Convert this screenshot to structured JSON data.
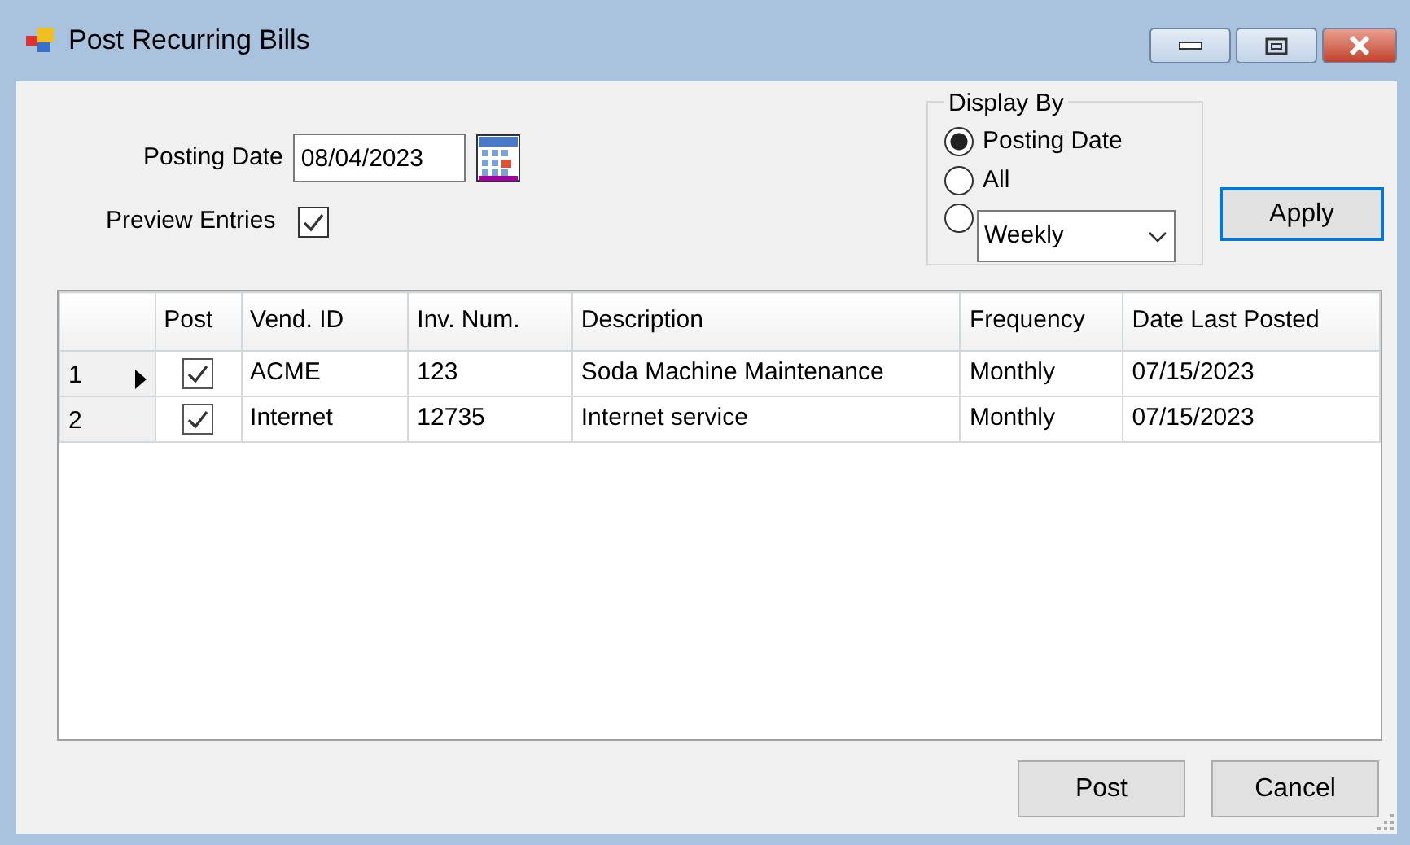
{
  "window": {
    "title": "Post Recurring Bills"
  },
  "posting_date": {
    "label": "Posting Date",
    "value": "08/04/2023"
  },
  "preview_entries": {
    "label": "Preview Entries",
    "checked": true
  },
  "display_by": {
    "title": "Display By",
    "options": [
      {
        "kind": "label",
        "label": "Posting Date",
        "selected": true
      },
      {
        "kind": "label",
        "label": "All",
        "selected": false
      },
      {
        "kind": "dropdown",
        "value": "Weekly",
        "selected": false
      }
    ]
  },
  "apply_button": "Apply",
  "table": {
    "columns": [
      "Post",
      "Vend. ID",
      "Inv. Num.",
      "Description",
      "Frequency",
      "Date Last Posted"
    ],
    "rows": [
      {
        "number": "1",
        "current": true,
        "post": true,
        "vend_id": "ACME",
        "inv_num": "123",
        "description": "Soda Machine Maintenance",
        "frequency": "Monthly",
        "date_last_posted": "07/15/2023"
      },
      {
        "number": "2",
        "current": false,
        "post": true,
        "vend_id": "Internet",
        "inv_num": "12735",
        "description": "Internet service",
        "frequency": "Monthly",
        "date_last_posted": "07/15/2023"
      }
    ]
  },
  "buttons": [
    "Post",
    "Cancel"
  ]
}
